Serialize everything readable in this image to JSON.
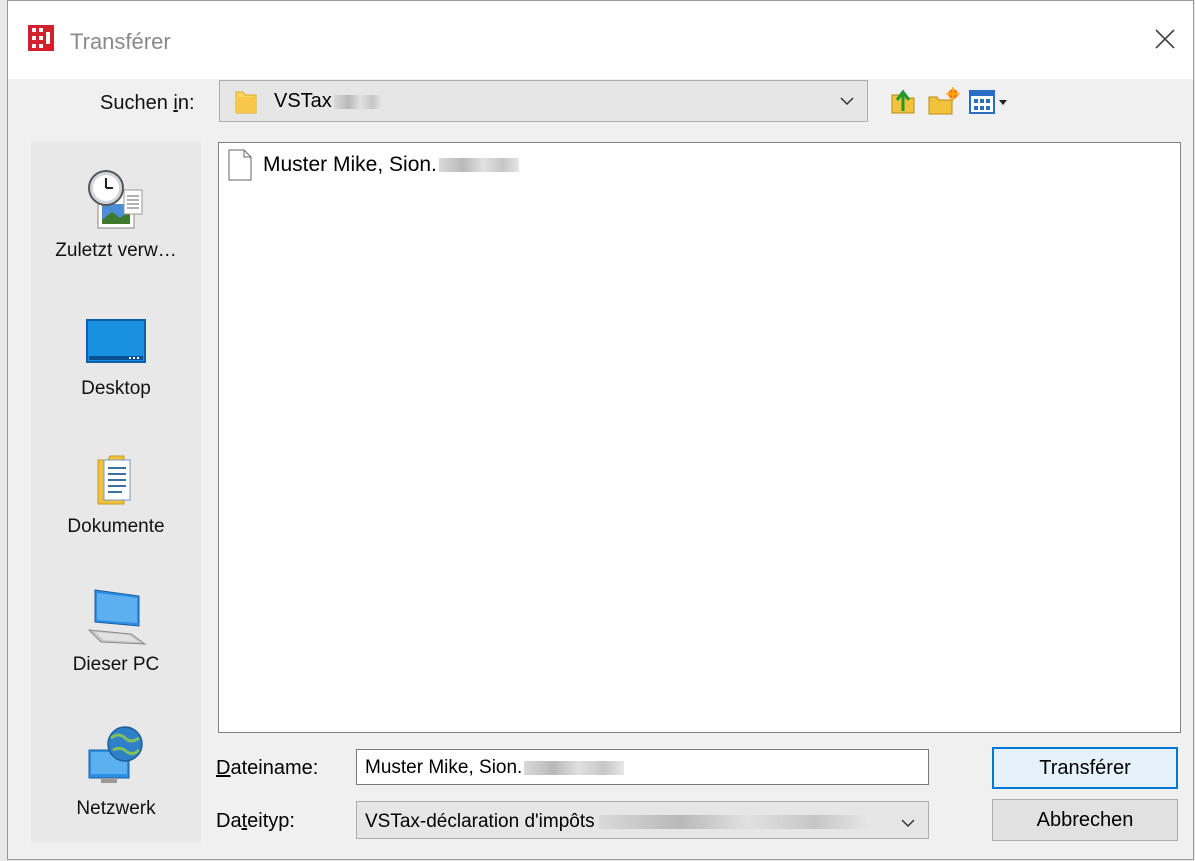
{
  "window": {
    "title": "Transférer",
    "close_icon": "close-icon",
    "app_icon": "app-logo-icon"
  },
  "lookin": {
    "label_pre": "Suchen ",
    "label_mnemonic": "i",
    "label_post": "n:",
    "value": "VSTax",
    "icon": "folder-icon"
  },
  "toolbar": {
    "buttons": [
      "up-one-level-icon",
      "new-folder-icon",
      "view-menu-icon"
    ]
  },
  "places": [
    {
      "label": "Zuletzt verw…",
      "icon": "recent-places-icon"
    },
    {
      "label": "Desktop",
      "icon": "desktop-icon"
    },
    {
      "label": "Dokumente",
      "icon": "documents-icon"
    },
    {
      "label": "Dieser PC",
      "icon": "this-pc-icon"
    },
    {
      "label": "Netzwerk",
      "icon": "network-icon"
    }
  ],
  "files": [
    {
      "name": "Muster Mike, Sion.",
      "icon": "document-file-icon"
    }
  ],
  "filename": {
    "label_mnemonic": "D",
    "label_rest": "ateiname:",
    "value": "Muster Mike, Sion."
  },
  "filetype": {
    "label_pre": "Da",
    "label_mnemonic": "t",
    "label_post": "eityp:",
    "value": "VSTax-déclaration d'impôts"
  },
  "buttons": {
    "primary": "Transférer",
    "cancel": "Abbrechen"
  },
  "colors": {
    "accent": "#0078d7",
    "brand_red": "#d4202c"
  }
}
